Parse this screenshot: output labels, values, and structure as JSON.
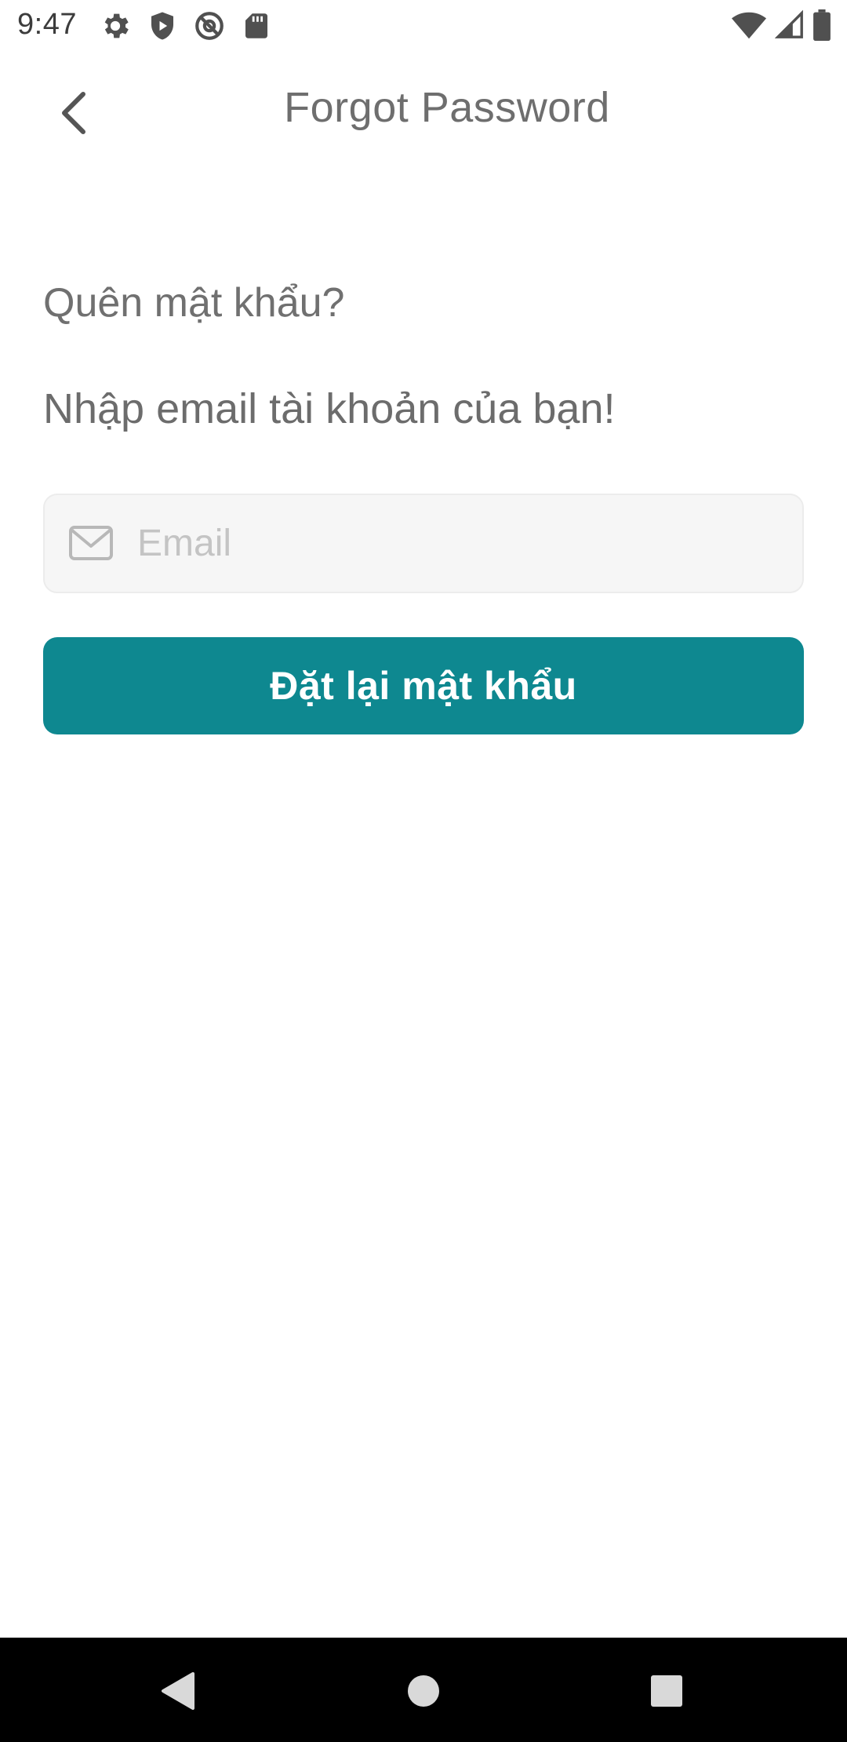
{
  "status_bar": {
    "time": "9:47",
    "left_icons": [
      "gear-icon",
      "shield-icon",
      "at-sign-icon",
      "sd-card-icon"
    ],
    "right_icons": [
      "wifi-icon",
      "signal-icon",
      "battery-icon"
    ]
  },
  "header": {
    "title": "Forgot Password",
    "back_icon": "chevron-left-icon"
  },
  "content": {
    "question": "Quên mật khẩu?",
    "instruction": "Nhập email tài khoản của bạn!",
    "email_field": {
      "placeholder": "Email",
      "value": "",
      "icon": "mail-icon"
    },
    "reset_button_label": "Đặt lại mật khẩu"
  },
  "nav_bar": {
    "buttons": [
      "back-triangle-icon",
      "home-circle-icon",
      "recents-square-icon"
    ]
  },
  "colors": {
    "accent": "#0e8890",
    "field_bg": "#f6f6f6",
    "text_gray": "#6e6e6e",
    "nav_bg": "#000000"
  }
}
